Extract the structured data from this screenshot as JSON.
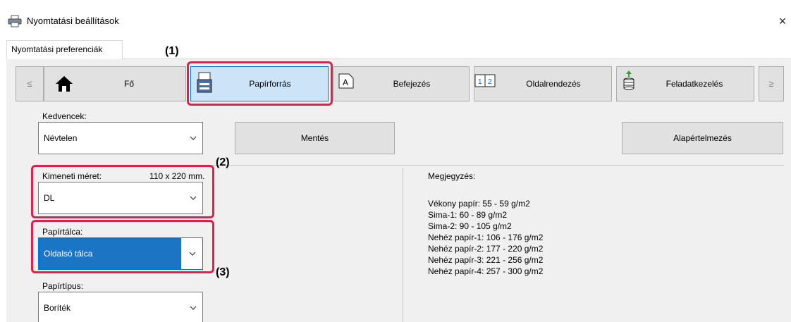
{
  "window": {
    "title": "Nyomtatási beállítások",
    "close_glyph": "×"
  },
  "tab": {
    "label": "Nyomtatási preferenciák"
  },
  "nav": {
    "prev_glyph": "≤",
    "next_glyph": "≥",
    "items": [
      {
        "label": "Fő",
        "icon": "home-icon"
      },
      {
        "label": "Papírforrás",
        "icon": "paper-tray-icon",
        "active": true
      },
      {
        "label": "Befejezés",
        "icon": "finishing-icon"
      },
      {
        "label": "Oldalrendezés",
        "icon": "layout-icon"
      },
      {
        "label": "Feladatkezelés",
        "icon": "job-handling-icon"
      }
    ]
  },
  "favorites": {
    "label": "Kedvencek:",
    "value": "Névtelen",
    "save_label": "Mentés",
    "default_label": "Alapértelmezés"
  },
  "output_size": {
    "label": "Kimeneti méret:",
    "dimension": "110 x 220 mm.",
    "value": "DL"
  },
  "paper_tray": {
    "label": "Papírtálca:",
    "value": "Oldalsó tálca"
  },
  "paper_type": {
    "label": "Papírtípus:",
    "value": "Boríték"
  },
  "notes": {
    "heading": "Megjegyzés:",
    "lines": [
      "Vékony papír: 55 - 59 g/m2",
      "Sima-1: 60 - 89 g/m2",
      "Sima-2: 90 - 105 g/m2",
      "Nehéz papír-1: 106 - 176 g/m2",
      "Nehéz papír-2: 177 - 220 g/m2",
      "Nehéz papír-3: 221 - 256 g/m2",
      "Nehéz papír-4: 257 - 300 g/m2"
    ]
  },
  "callouts": {
    "c1": "(1)",
    "c2": "(2)",
    "c3": "(3)"
  },
  "colors": {
    "accent": "#e21f4a",
    "selection": "#1c74c4",
    "active_tab": "#cce4f7"
  }
}
